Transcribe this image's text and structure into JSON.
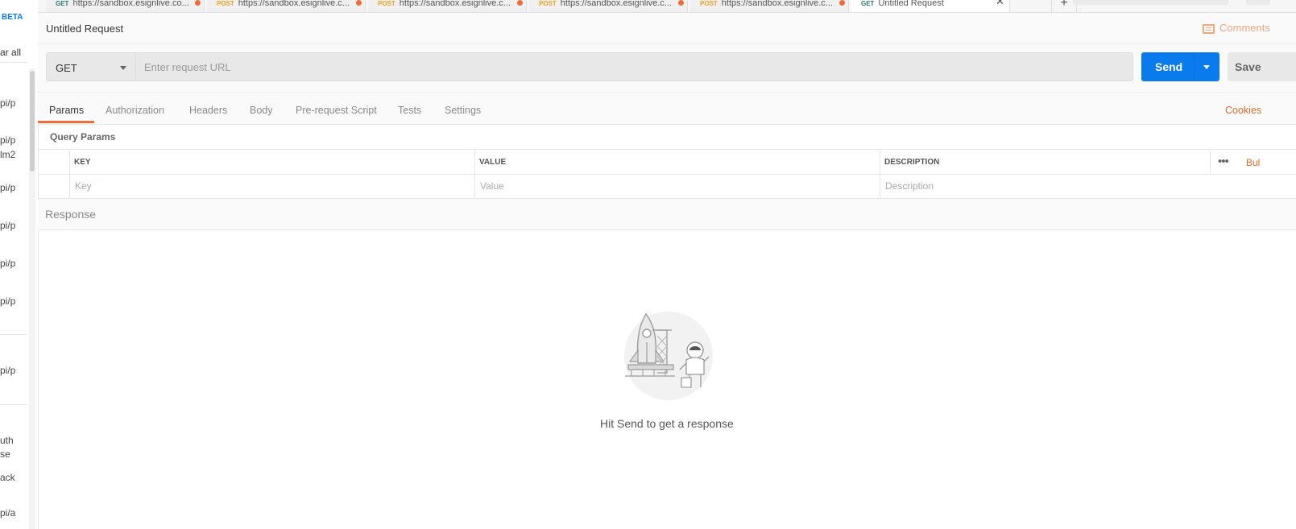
{
  "sidebar": {
    "beta_label": "BETA",
    "clear_label": "ar all",
    "fragments": [
      "pi/p",
      "pi/p",
      "lm2",
      "pi/p",
      "pi/p",
      "pi/p",
      "pi/p",
      "pi/p",
      "uth",
      "se",
      "ack",
      "pi/a"
    ]
  },
  "tabs": [
    {
      "method": "GET",
      "url": "https://sandbox.esignlive.co...",
      "unsaved": true
    },
    {
      "method": "POST",
      "url": "https://sandbox.esignlive.c...",
      "unsaved": true
    },
    {
      "method": "POST",
      "url": "https://sandbox.esignlive.c...",
      "unsaved": true
    },
    {
      "method": "POST",
      "url": "https://sandbox.esignlive.c...",
      "unsaved": true
    },
    {
      "method": "POST",
      "url": "https://sandbox.esignlive.c...",
      "unsaved": true
    },
    {
      "method": "GET",
      "url": "Untitled Request",
      "active": true
    }
  ],
  "tabbar": {
    "close": "✕",
    "plus": "+",
    "more": "•••"
  },
  "request": {
    "title": "Untitled Request",
    "comments_label": "Comments",
    "method": "GET",
    "url_placeholder": "Enter request URL",
    "url_value": "",
    "send_label": "Send",
    "save_label": "Save"
  },
  "subtabs": [
    "Params",
    "Authorization",
    "Headers",
    "Body",
    "Pre-request Script",
    "Tests",
    "Settings"
  ],
  "cookies_label": "Cookies",
  "params": {
    "title": "Query Params",
    "columns": [
      "KEY",
      "VALUE",
      "DESCRIPTION"
    ],
    "placeholders": [
      "Key",
      "Value",
      "Description"
    ],
    "more": "•••",
    "bulk_label": "Bul"
  },
  "response": {
    "title": "Response",
    "hint": "Hit Send to get a response"
  }
}
